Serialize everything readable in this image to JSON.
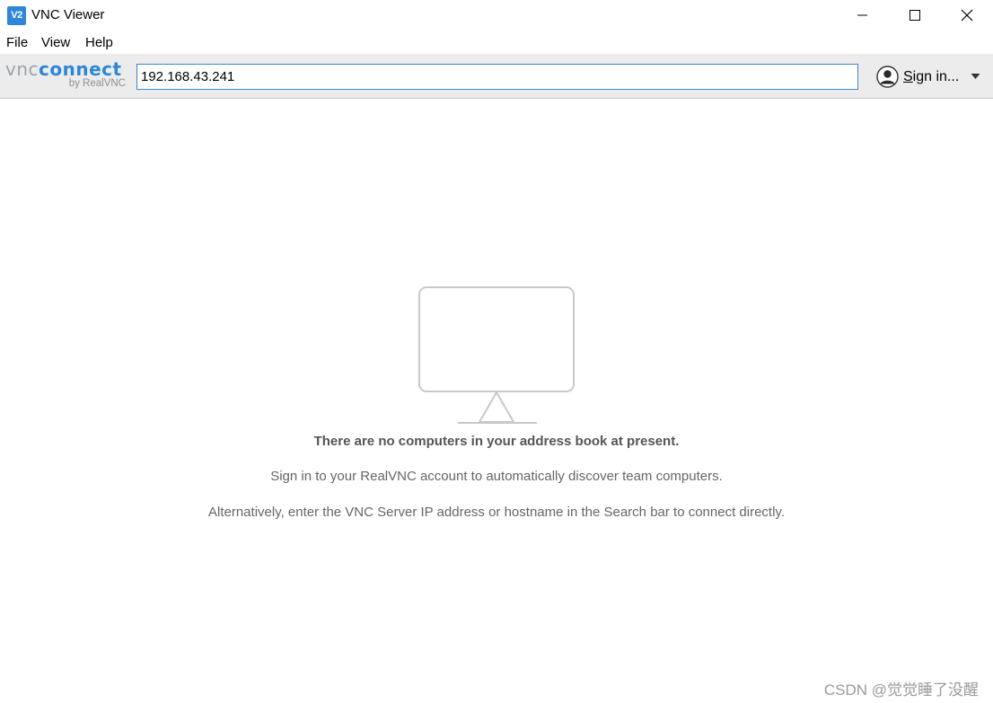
{
  "window": {
    "title": "VNC Viewer",
    "app_icon_text": "V2",
    "accent_color": "#2f86d8"
  },
  "menu": {
    "items": [
      {
        "label": "File"
      },
      {
        "label": "View"
      },
      {
        "label": "Help"
      }
    ]
  },
  "toolbar": {
    "logo_vnc": "vnc",
    "logo_connect": "connect",
    "logo_sub": "by RealVNC",
    "address_value": "192.168.43.241",
    "signin_label": "Sign in...",
    "signin_underline_char": "S",
    "signin_rest": "ign in..."
  },
  "empty_state": {
    "heading": "There are no computers in your address book at present.",
    "line1": "Sign in to your RealVNC account to automatically discover team computers.",
    "line2": "Alternatively, enter the VNC Server IP address or hostname in the Search bar to connect directly.",
    "icon": "monitor-icon"
  },
  "watermark": "CSDN @觉觉睡了没醒",
  "colors": {
    "logo_blue": "#2e86d6",
    "input_border": "#3d87c8",
    "toolbar_bg": "#ececec"
  }
}
